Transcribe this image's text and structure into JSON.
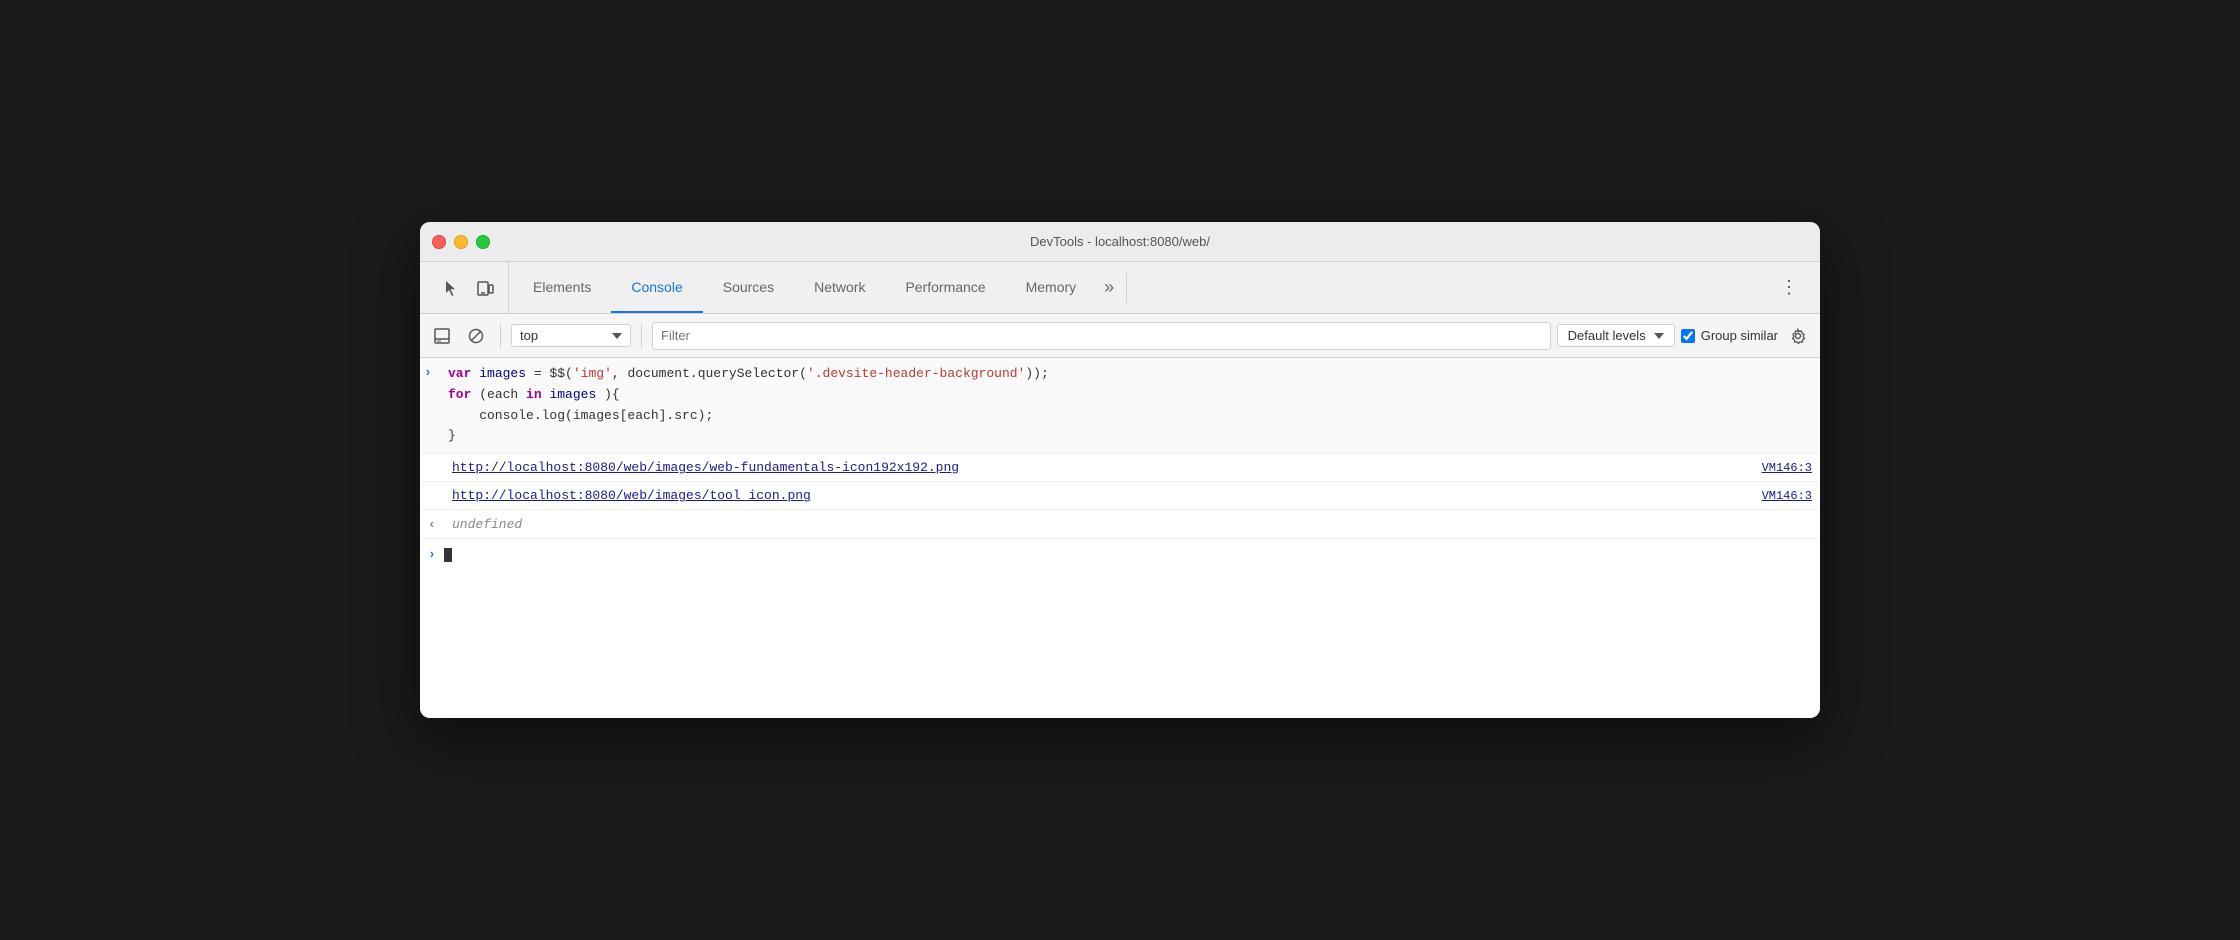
{
  "window": {
    "title": "DevTools - localhost:8080/web/"
  },
  "tabs": {
    "items": [
      {
        "id": "elements",
        "label": "Elements",
        "active": false
      },
      {
        "id": "console",
        "label": "Console",
        "active": true
      },
      {
        "id": "sources",
        "label": "Sources",
        "active": false
      },
      {
        "id": "network",
        "label": "Network",
        "active": false
      },
      {
        "id": "performance",
        "label": "Performance",
        "active": false
      },
      {
        "id": "memory",
        "label": "Memory",
        "active": false
      }
    ],
    "more_icon": "»",
    "menu_icon": "⋮"
  },
  "toolbar": {
    "context_value": "top",
    "filter_placeholder": "Filter",
    "levels_label": "Default levels",
    "group_similar_label": "Group similar"
  },
  "console": {
    "code": {
      "line1_parts": [
        {
          "type": "kw-var",
          "text": "var"
        },
        {
          "type": "plain",
          "text": " "
        },
        {
          "type": "var-name",
          "text": "images"
        },
        {
          "type": "plain",
          "text": " = $$("
        },
        {
          "type": "string",
          "text": "'img'"
        },
        {
          "type": "plain",
          "text": ", document.querySelector("
        },
        {
          "type": "string",
          "text": "'.devsite-header-background'"
        },
        {
          "type": "plain",
          "text": "));"
        }
      ],
      "line2_parts": [
        {
          "type": "kw-for",
          "text": "for"
        },
        {
          "type": "plain",
          "text": " (each "
        },
        {
          "type": "kw-in",
          "text": "in"
        },
        {
          "type": "plain",
          "text": " "
        },
        {
          "type": "var-name",
          "text": "images"
        },
        {
          "type": "plain",
          "text": "){"
        }
      ],
      "line3_parts": [
        {
          "type": "plain",
          "text": "    console.log(images[each].src);"
        }
      ],
      "line4_parts": [
        {
          "type": "plain",
          "text": "}"
        }
      ]
    },
    "outputs": [
      {
        "type": "link",
        "text": "http://localhost:8080/web/images/web-fundamentals-icon192x192.png",
        "ref": "VM146:3"
      },
      {
        "type": "link",
        "text": "http://localhost:8080/web/images/tool_icon.png",
        "ref": "VM146:3"
      }
    ],
    "undefined_text": "undefined"
  }
}
